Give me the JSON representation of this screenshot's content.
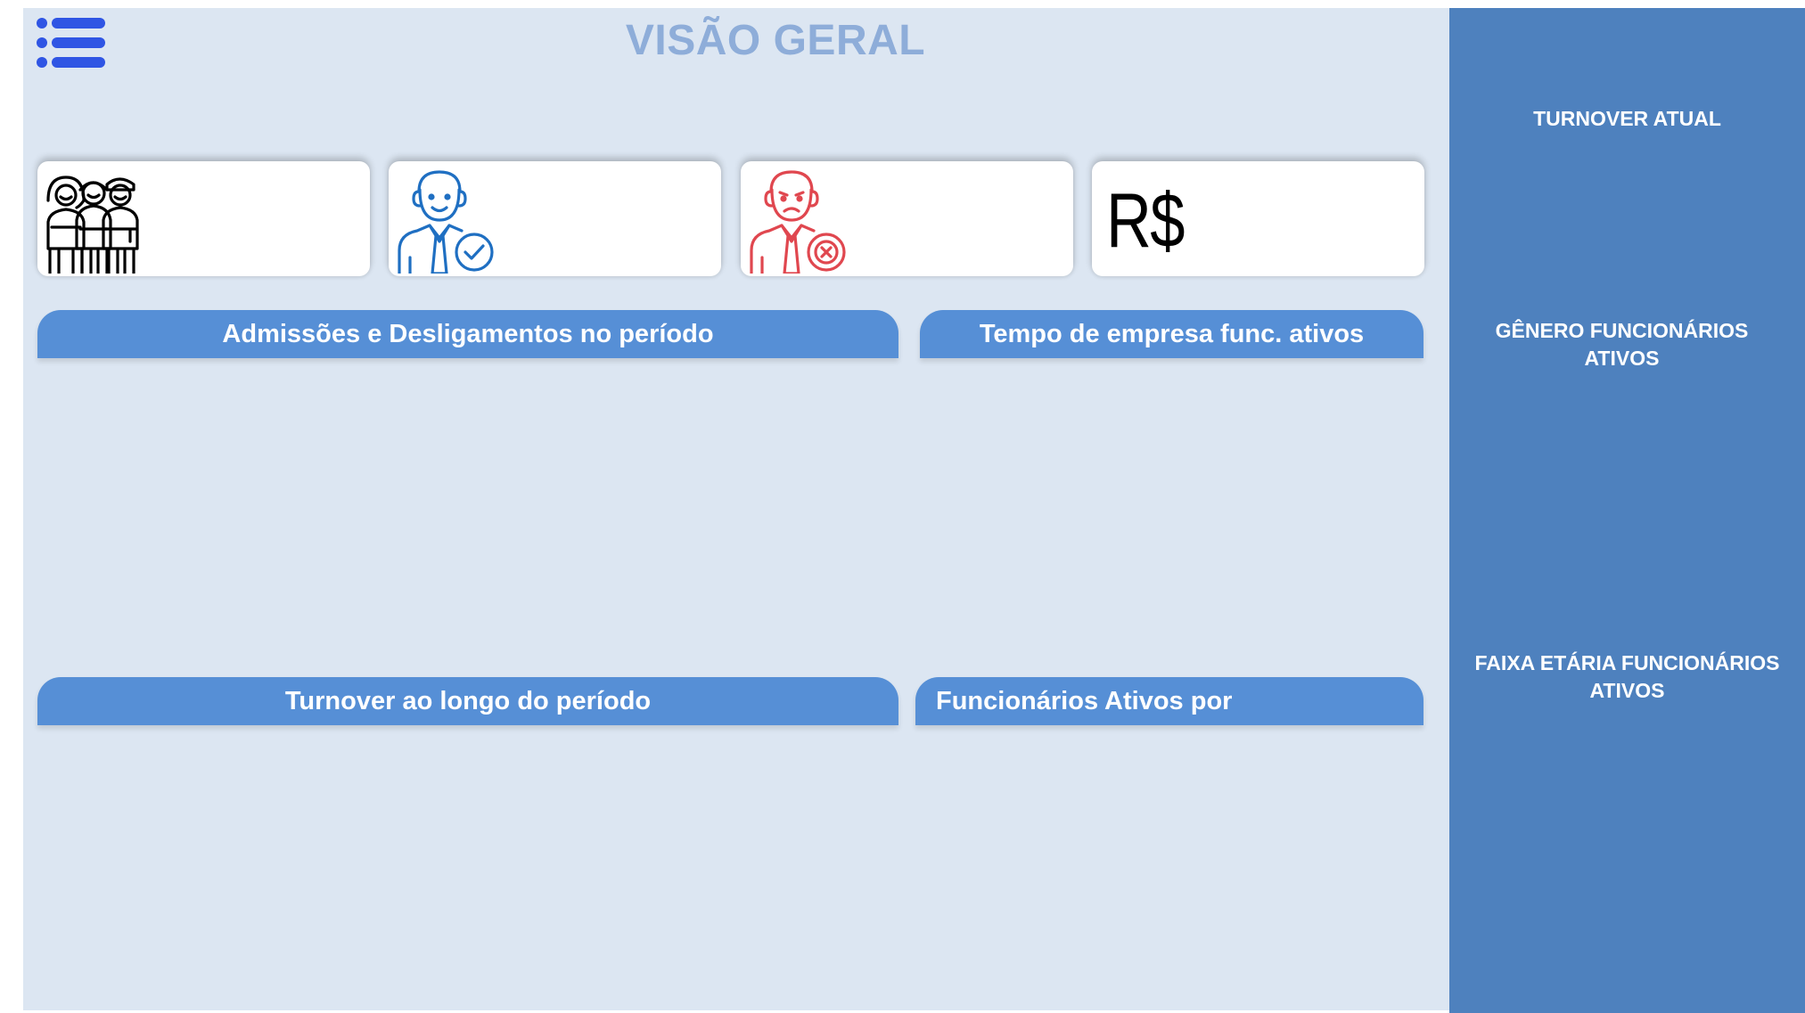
{
  "header": {
    "title": "VISÃO GERAL",
    "menu_icon": "list-icon"
  },
  "kpi_cards": [
    {
      "icon": "team-people-icon"
    },
    {
      "icon": "employee-check-icon"
    },
    {
      "icon": "employee-x-icon"
    },
    {
      "icon": "currency-real-icon",
      "text": "R$"
    }
  ],
  "sections": {
    "admissoes": "Admissões e Desligamentos no período",
    "tempo_empresa": "Tempo de empresa func. ativos",
    "turnover_periodo": "Turnover ao longo do período",
    "funcionarios_ativos": "Funcionários Ativos por"
  },
  "right_panel": {
    "turnover_atual": "TURNOVER ATUAL",
    "genero_line1": "GÊNERO FUNCIONÁRIOS",
    "genero_line2": "ATIVOS",
    "faixa_line1": "FAIXA ETÁRIA FUNCIONÁRIOS",
    "faixa_line2": "ATIVOS"
  },
  "colors": {
    "canvas_bg": "#dce6f2",
    "panel_bg": "#4e81be",
    "header_blue": "#568fd6",
    "title_color": "#8eadd9",
    "menu_icon_color": "#2f55e4",
    "hire_icon_color": "#1f6fc2",
    "fire_icon_color": "#e0474f"
  }
}
